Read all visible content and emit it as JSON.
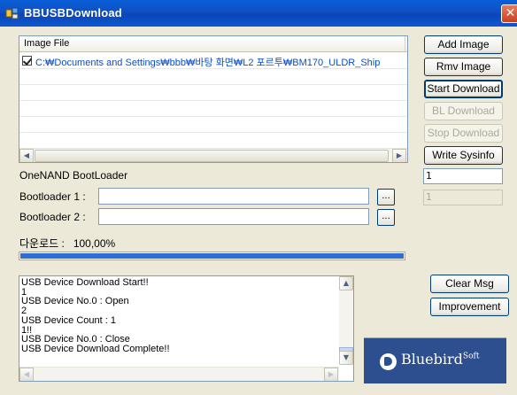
{
  "window": {
    "title": "BBUSBDownload",
    "close_glyph": "✕"
  },
  "image_list": {
    "column_header": "Image File",
    "rows": [
      {
        "checked": true,
        "path": "C:₩Documents and Settings₩bbb₩바탕 화면₩L2 포르투₩BM170_ULDR_Ship"
      }
    ]
  },
  "buttons": {
    "add_image": "Add Image",
    "rmv_image": "Rmv Image",
    "start_download": "Start Download",
    "bl_download": "BL Download",
    "stop_download": "Stop Download",
    "write_sysinfo": "Write Sysinfo",
    "clear_msg": "Clear Msg",
    "improvement": "Improvement",
    "browse": "..."
  },
  "sysinfo": {
    "value": "1",
    "disabled_value": "1"
  },
  "bootloader": {
    "section_label": "OneNAND BootLoader",
    "bl1_label": "Bootloader 1 :",
    "bl1_value": "",
    "bl2_label": "Bootloader 2 :",
    "bl2_value": ""
  },
  "progress": {
    "label": "다운로드 :   100,00%",
    "fraction": 1.0
  },
  "messages": [
    "USB Device Download Start!!",
    "1",
    "USB Device No.0 : Open",
    "2",
    "USB Device Count : 1",
    "1!!",
    "USB Device No.0 : Close",
    "USB Device Download Complete!!"
  ],
  "logo": {
    "brand": "Bluebird",
    "suffix": "Soft"
  },
  "icons": {
    "app": "app-icon",
    "close": "close-icon",
    "scroll_left": "arrow-left-icon",
    "scroll_right": "arrow-right-icon",
    "scroll_up": "arrow-up-icon",
    "scroll_down": "arrow-down-icon"
  },
  "colors": {
    "titlebar": "#0a46b8",
    "progress": "#2e6cd6",
    "path_text": "#0b4fc6",
    "logo_bg": "#2e4f8f"
  }
}
